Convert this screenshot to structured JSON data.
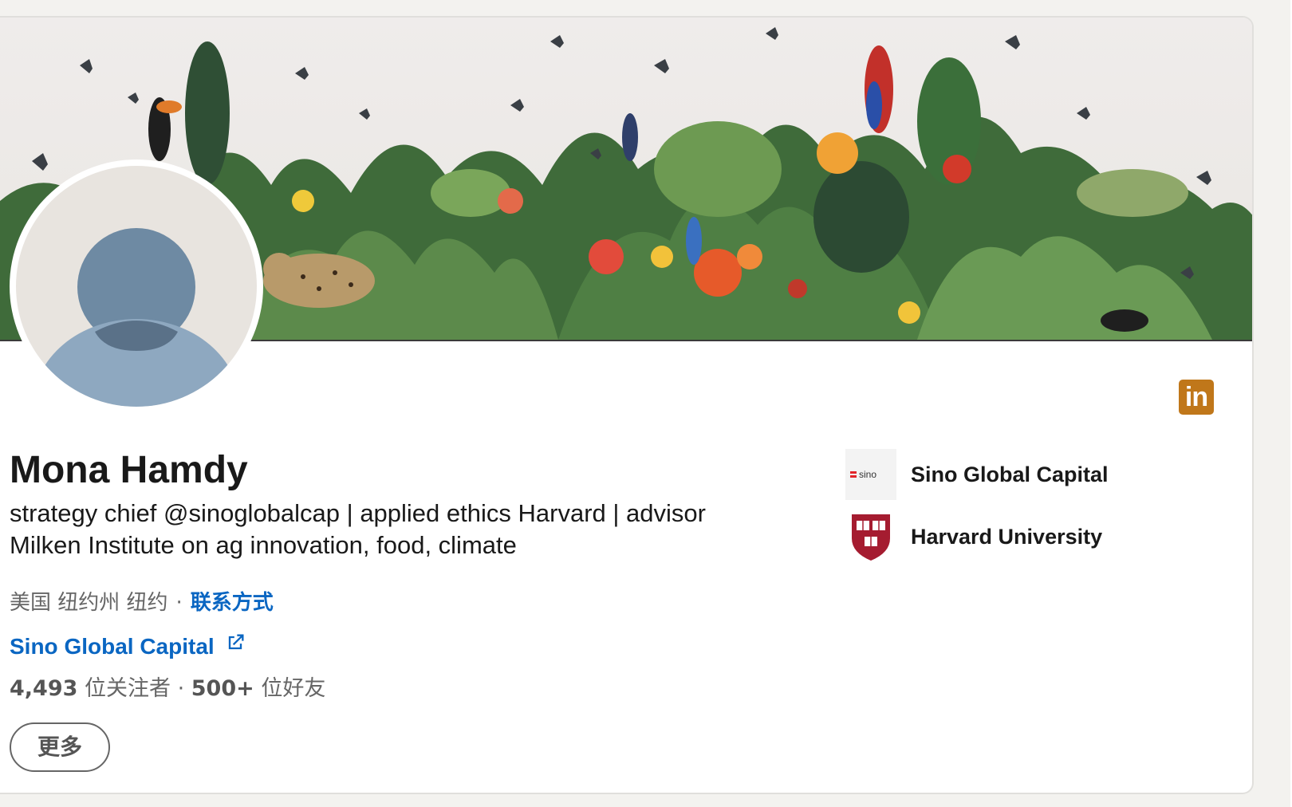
{
  "profile": {
    "name": "Mona Hamdy",
    "headline": "strategy chief @sinoglobalcap | applied ethics Harvard | advisor Milken Institute on ag innovation, food, climate",
    "location": "美国 纽约州 纽约",
    "contact_label": "联系方式",
    "website_label": "Sino Global Capital",
    "followers_count": "4,493",
    "followers_label": "位关注者",
    "connections_count": "500+",
    "connections_label": "位好友",
    "more_button": "更多"
  },
  "organizations": [
    {
      "name": "Sino Global Capital",
      "icon": "sino-global-capital-logo"
    },
    {
      "name": "Harvard University",
      "icon": "harvard-shield-logo"
    }
  ],
  "brand": {
    "icon": "linkedin-icon",
    "color": "#c0771a"
  },
  "colors": {
    "link": "#0a66c2",
    "text": "#191919",
    "muted": "#666666"
  }
}
